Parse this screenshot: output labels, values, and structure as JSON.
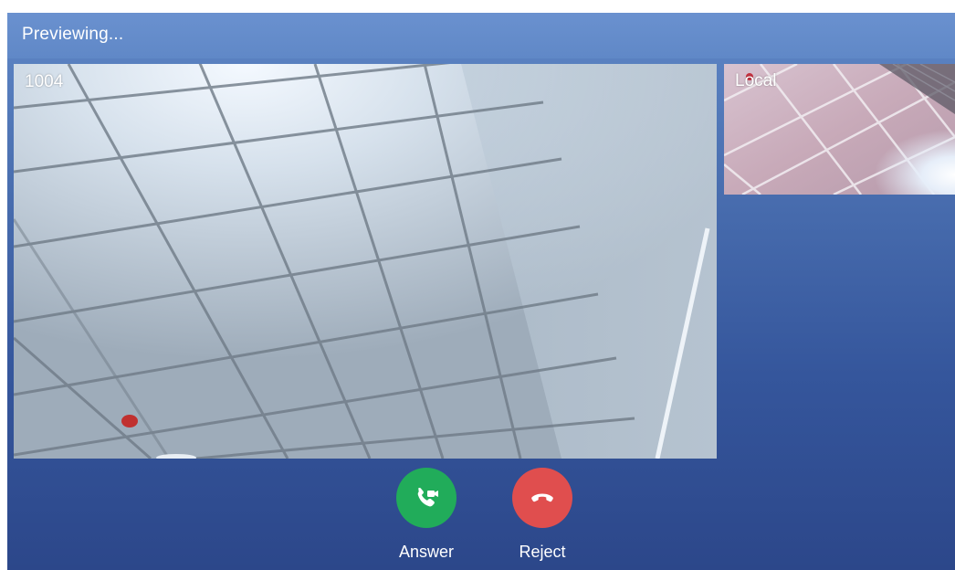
{
  "status_bar": {
    "text": "Previewing..."
  },
  "remote_video": {
    "caller_label": "1004"
  },
  "local_video": {
    "label": "Local"
  },
  "actions": {
    "answer": {
      "label": "Answer",
      "color": "#21ac5a",
      "icon": "video-call-answer-icon"
    },
    "reject": {
      "label": "Reject",
      "color": "#e04e4e",
      "icon": "hang-up-icon"
    }
  }
}
